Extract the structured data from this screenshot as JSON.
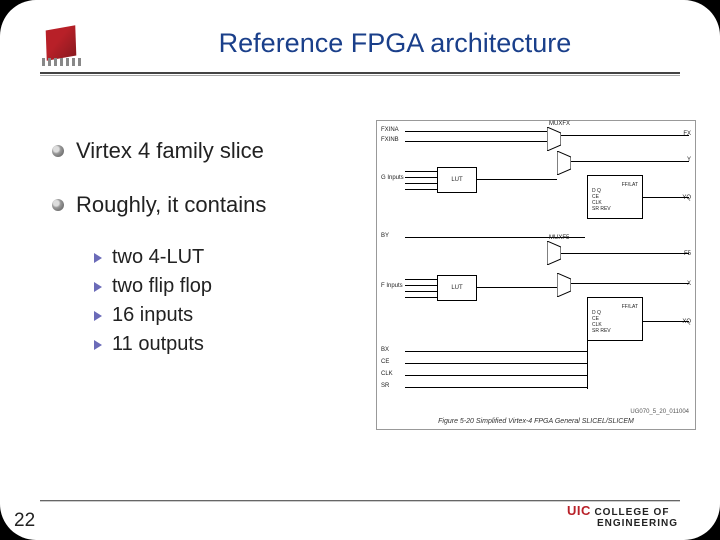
{
  "title": "Reference FPGA architecture",
  "bullets": [
    "Virtex 4 family slice",
    "Roughly, it contains"
  ],
  "subbullets": [
    "two 4-LUT",
    "two flip flop",
    "16 inputs",
    "11 outputs"
  ],
  "diagram": {
    "caption": "Figure 5-20   Simplified Virtex-4 FPGA General SLICEL/SLICEM",
    "code": "UG070_5_20_011004",
    "labels_left": [
      "FXINA",
      "FXINB",
      "G Inputs",
      "BY",
      "F Inputs",
      "BX",
      "CE",
      "CLK",
      "SR"
    ],
    "labels_right": [
      "FX",
      "Y",
      "YQ",
      "F5",
      "X",
      "XQ"
    ],
    "blocks": [
      "LUT",
      "MUXFX",
      "FF/LAT",
      "D  Q",
      "CE",
      "CLK",
      "SR  REV",
      "MUXF5",
      "LUT",
      "FF/LAT",
      "D  Q",
      "CE",
      "CLK",
      "SR  REV"
    ]
  },
  "page_number": "22",
  "footer": {
    "uic": "UIC",
    "line1": "COLLEGE OF",
    "line2": "ENGINEERING"
  }
}
